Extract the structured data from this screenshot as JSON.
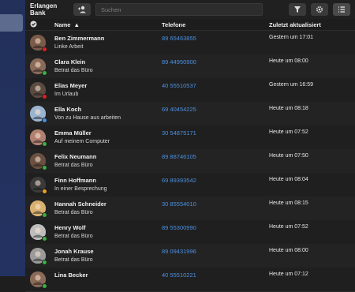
{
  "app": {
    "title": "Erlangen Bank"
  },
  "search": {
    "placeholder": "Suchen"
  },
  "columns": {
    "name": "Name",
    "phone": "Telefone",
    "updated": "Zuletzt aktualisiert"
  },
  "sort_indicator": "▲",
  "colors": {
    "accent": "#4a90e2",
    "online": "#3cb043",
    "busy": "#e02020",
    "away": "#f0a020"
  },
  "contacts": [
    {
      "name": "Ben Zimmermann",
      "status_text": "Linke Arbeit",
      "phone": "89 65463855",
      "updated": "Gestern um 17:01",
      "status": "busy",
      "avatar_color": "#7a5a48"
    },
    {
      "name": "Clara Klein",
      "status_text": "Betrat das Büro",
      "phone": "89 44950900",
      "updated": "Heute um 08:00",
      "status": "online",
      "avatar_color": "#8a6a58"
    },
    {
      "name": "Elias Meyer",
      "status_text": "Im Urlaub",
      "phone": "40 55510537",
      "updated": "Gestern um 16:59",
      "status": "busy",
      "avatar_color": "#5a4a40"
    },
    {
      "name": "Ella Koch",
      "status_text": "Von zu Hause aus arbeiten",
      "phone": "69 40454225",
      "updated": "Heute um 08:18",
      "status": "home",
      "avatar_color": "#9ab4d0"
    },
    {
      "name": "Emma Müller",
      "status_text": "Auf meinem Computer",
      "phone": "30 54875171",
      "updated": "Heute um 07:52",
      "status": "online",
      "avatar_color": "#b08070"
    },
    {
      "name": "Felix Neumann",
      "status_text": "Betrat das Büro",
      "phone": "89 88746105",
      "updated": "Heute um 07:50",
      "status": "online",
      "avatar_color": "#6a5040"
    },
    {
      "name": "Finn Hoffmann",
      "status_text": "In einer Besprechung",
      "phone": "69 89393542",
      "updated": "Heute um 08:04",
      "status": "away",
      "avatar_color": "#3a3a3a"
    },
    {
      "name": "Hannah Schneider",
      "status_text": "Betrat das Büro",
      "phone": "30 85554010",
      "updated": "Heute um 08:15",
      "status": "online",
      "avatar_color": "#d8b070"
    },
    {
      "name": "Henry Wolf",
      "status_text": "Betrat das Büro",
      "phone": "89 55300990",
      "updated": "Heute um 07:52",
      "status": "online",
      "avatar_color": "#bdbdbd"
    },
    {
      "name": "Jonah Krause",
      "status_text": "Betrat das Büro",
      "phone": "89 09431996",
      "updated": "Heute um 08:00",
      "status": "online",
      "avatar_color": "#9a9a9a"
    },
    {
      "name": "Lina Becker",
      "status_text": "",
      "phone": "40 55510221",
      "updated": "Heute um 07:12",
      "status": "online",
      "avatar_color": "#8a6a58"
    }
  ]
}
